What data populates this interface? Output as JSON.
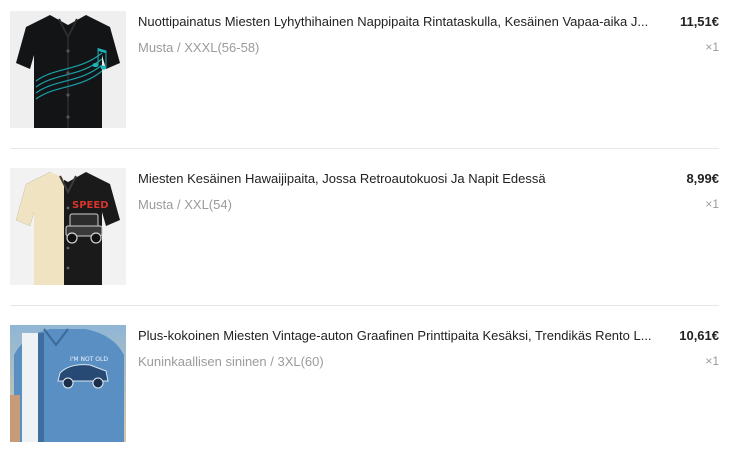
{
  "items": [
    {
      "image": "shirt-black-music-note-icon",
      "title": "Nuottipainatus Miesten Lyhythihainen Nappipaita Rintataskulla, Kesäinen Vapaa-aika J...",
      "variant": "Musta / XXXL(56-58)",
      "price": "11,51€",
      "quantity": "×1"
    },
    {
      "image": "shirt-black-retro-car-icon",
      "title": "Miesten Kesäinen Hawaijipaita, Jossa Retroautokuosi Ja Napit Edessä",
      "variant": "Musta / XXL(54)",
      "price": "8,99€",
      "quantity": "×1"
    },
    {
      "image": "shirt-blue-vintage-car-icon",
      "title": "Plus-kokoinen Miesten Vintage-auton Graafinen Printtipaita Kesäksi, Trendikäs Rento L...",
      "variant": "Kuninkaallisen sininen / 3XL(60)",
      "price": "10,61€",
      "quantity": "×1"
    }
  ],
  "colors": {
    "title": "#222222",
    "muted": "#9b9b9b",
    "divider": "#e7e7e7"
  }
}
